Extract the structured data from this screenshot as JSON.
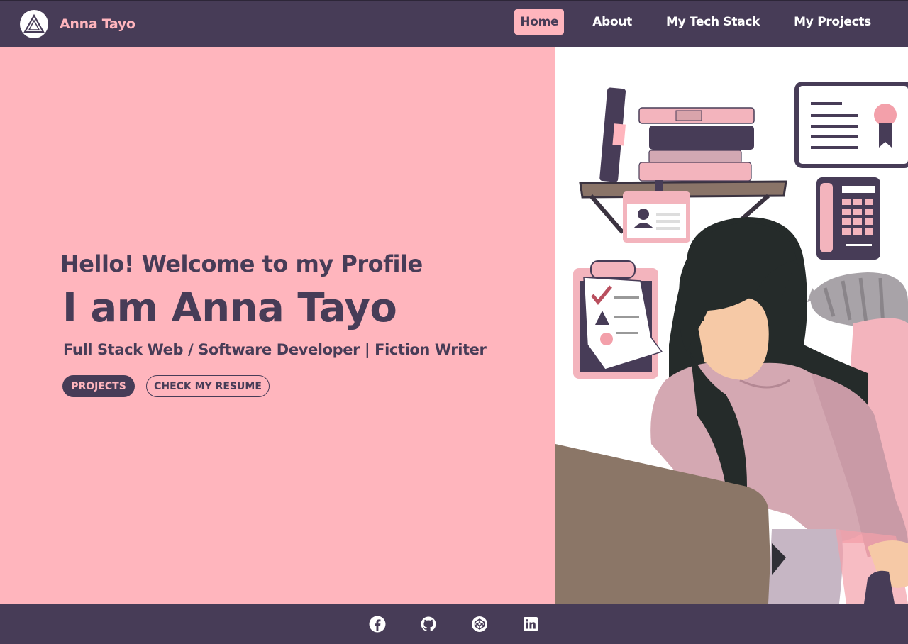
{
  "brand": {
    "name": "Anna Tayo",
    "logo_icon": "triangle-logo-icon"
  },
  "nav": {
    "items": [
      {
        "label": "Home",
        "active": true
      },
      {
        "label": "About",
        "active": false
      },
      {
        "label": "My Tech Stack",
        "active": false
      },
      {
        "label": "My Projects",
        "active": false
      }
    ]
  },
  "hero": {
    "greeting": "Hello! Welcome to my Profile",
    "headline": "I am Anna Tayo",
    "subtitle": "Full Stack Web / Software Developer | Fiction Writer",
    "buttons": {
      "projects": "PROJECTS",
      "resume": "CHECK MY RESUME"
    },
    "illustration": "woman-at-laptop-illustration"
  },
  "footer": {
    "social": [
      "facebook-icon",
      "github-icon",
      "codepen-icon",
      "linkedin-icon"
    ]
  },
  "colors": {
    "primary": "#473c57",
    "accent": "#ffb5bd"
  }
}
